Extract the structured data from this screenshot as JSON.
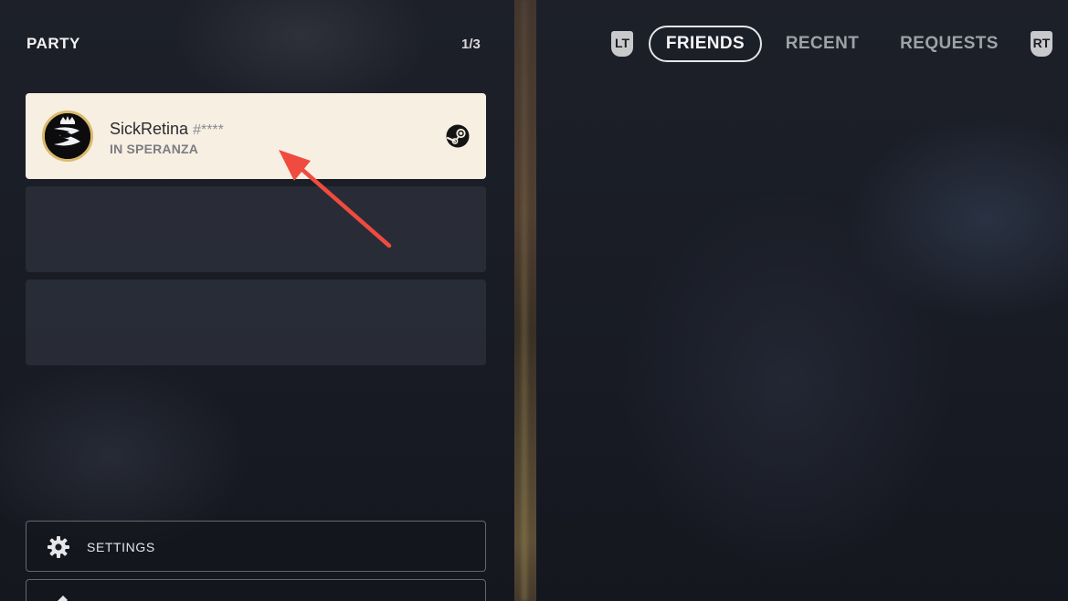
{
  "party": {
    "title": "PARTY",
    "count": "1/3",
    "members": [
      {
        "name": "SickRetina",
        "tag": "#****",
        "status": "IN SPERANZA",
        "platform_icon": "steam-icon",
        "avatar_icon": "halo-3-emblem-icon"
      }
    ],
    "empty_slots": 2
  },
  "menu": {
    "settings_label": "SETTINGS",
    "settings_icon": "gear-icon",
    "second_icon": "pencil-icon"
  },
  "tabs": {
    "left_trigger": "LT",
    "right_trigger": "RT",
    "items": [
      {
        "label": "FRIENDS",
        "active": true
      },
      {
        "label": "RECENT",
        "active": false
      },
      {
        "label": "REQUESTS",
        "active": false
      }
    ]
  },
  "colors": {
    "filled_slot": "#f7efe2",
    "empty_slot": "#3c404c",
    "annotation_arrow": "#ef4b3f",
    "avatar_ring": "#d9b96a"
  }
}
